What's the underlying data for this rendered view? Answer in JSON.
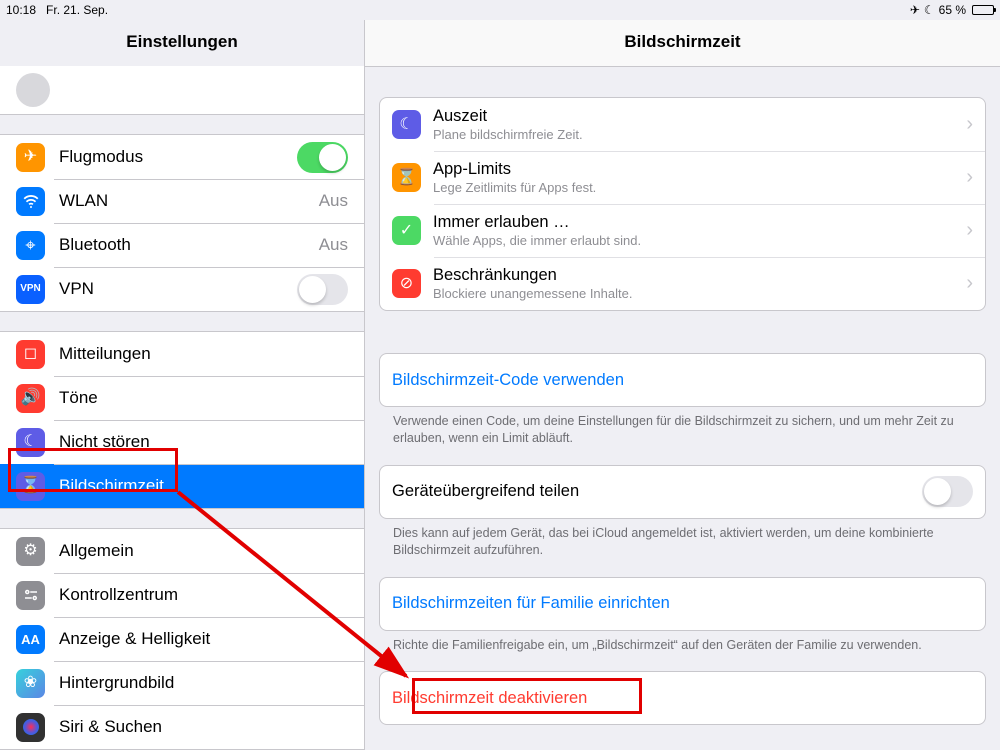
{
  "statusbar": {
    "time": "10:18",
    "date": "Fr. 21. Sep.",
    "battery_text": "65 %"
  },
  "sidebar": {
    "title": "Einstellungen",
    "groups": [
      [
        {
          "icon": "airplane-icon",
          "bg": "bg-orange",
          "label": "Flugmodus",
          "accessory": "switch-on"
        },
        {
          "icon": "wifi-icon",
          "bg": "bg-blue",
          "label": "WLAN",
          "value": "Aus"
        },
        {
          "icon": "bluetooth-icon",
          "bg": "bg-blue",
          "label": "Bluetooth",
          "value": "Aus"
        },
        {
          "icon": "vpn-icon",
          "bg": "bg-bluedeep",
          "label": "VPN",
          "accessory": "switch-off",
          "text_icon": "VPN"
        }
      ],
      [
        {
          "icon": "notifications-icon",
          "bg": "bg-red",
          "label": "Mitteilungen"
        },
        {
          "icon": "sounds-icon",
          "bg": "bg-red",
          "label": "Töne"
        },
        {
          "icon": "dnd-icon",
          "bg": "bg-indigo",
          "label": "Nicht stören"
        },
        {
          "icon": "screentime-icon",
          "bg": "bg-indigo",
          "label": "Bildschirmzeit",
          "selected": true
        }
      ],
      [
        {
          "icon": "general-icon",
          "bg": "bg-gray",
          "label": "Allgemein"
        },
        {
          "icon": "controlcenter-icon",
          "bg": "bg-gray",
          "label": "Kontrollzentrum"
        },
        {
          "icon": "display-icon",
          "bg": "bg-blue",
          "label": "Anzeige & Helligkeit",
          "text_icon": "AA"
        },
        {
          "icon": "wallpaper-icon",
          "bg": "bg-blue",
          "label": "Hintergrundbild"
        },
        {
          "icon": "siri-icon",
          "bg": "bg-slate",
          "label": "Siri & Suchen"
        }
      ]
    ]
  },
  "detail": {
    "title": "Bildschirmzeit",
    "features": [
      {
        "icon": "moon-icon",
        "bg": "bg-indigo",
        "title": "Auszeit",
        "sub": "Plane bildschirmfreie Zeit."
      },
      {
        "icon": "hourglass-icon",
        "bg": "bg-orange",
        "title": "App-Limits",
        "sub": "Lege Zeitlimits für Apps fest."
      },
      {
        "icon": "check-icon",
        "bg": "bg-green",
        "title": "Immer erlauben …",
        "sub": "Wähle Apps, die immer erlaubt sind."
      },
      {
        "icon": "nosign-icon",
        "bg": "bg-red",
        "title": "Beschränkungen",
        "sub": "Blockiere unangemessene Inhalte."
      }
    ],
    "passcode": {
      "label": "Bildschirmzeit-Code verwenden",
      "footer": "Verwende einen Code, um deine Einstellungen für die Bildschirmzeit zu sichern, und um mehr Zeit zu erlauben, wenn ein Limit abläuft."
    },
    "share": {
      "label": "Geräteübergreifend teilen",
      "footer": "Dies kann auf jedem Gerät, das bei iCloud angemeldet ist, aktiviert werden, um deine kombinierte Bildschirmzeit aufzuführen."
    },
    "family": {
      "label": "Bildschirmzeiten für Familie einrichten",
      "footer": "Richte die Familienfreigabe ein, um „Bildschirmzeit“ auf den Geräten der Familie zu verwenden."
    },
    "deactivate": {
      "label": "Bildschirmzeit deaktivieren"
    }
  }
}
